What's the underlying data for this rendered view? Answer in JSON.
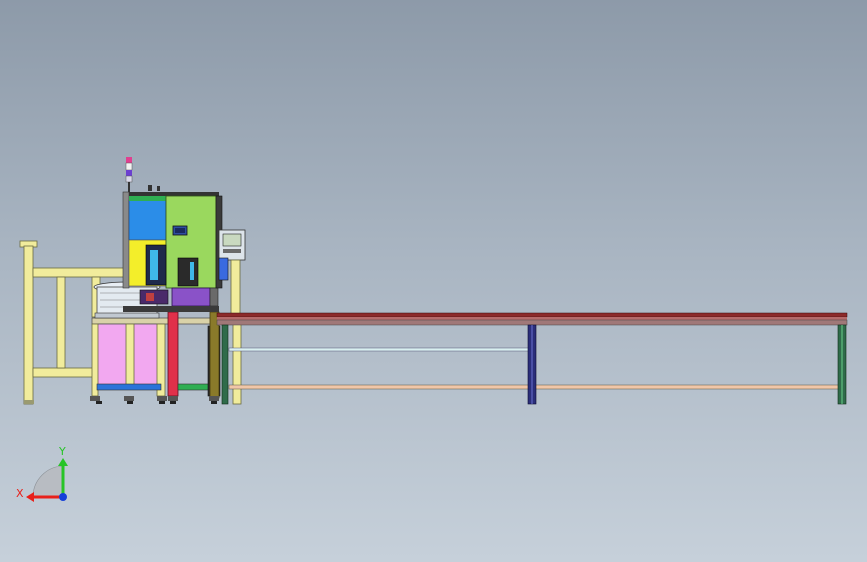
{
  "triad": {
    "x_label": "X",
    "y_label": "Y",
    "x_color": "#e8201a",
    "y_color": "#27c427",
    "z_color": "#1640d8"
  },
  "colors": {
    "frame": "#f1ec9c",
    "frame_edge": "#6a6a40",
    "conveyor_top": "#8c2a2a",
    "conveyor_rail": "#a07878",
    "leg_navy": "#2b2e7a",
    "leg_green": "#2f6b4a",
    "panel_green": "#9ad85e",
    "panel_blue": "#2b8de8",
    "cabinet_pink": "#f2a8f0",
    "column_red": "#e0304a",
    "purple_block": "#8a52c8",
    "yellow_panel": "#f3ee2a",
    "olive_post": "#8a7a2a"
  }
}
